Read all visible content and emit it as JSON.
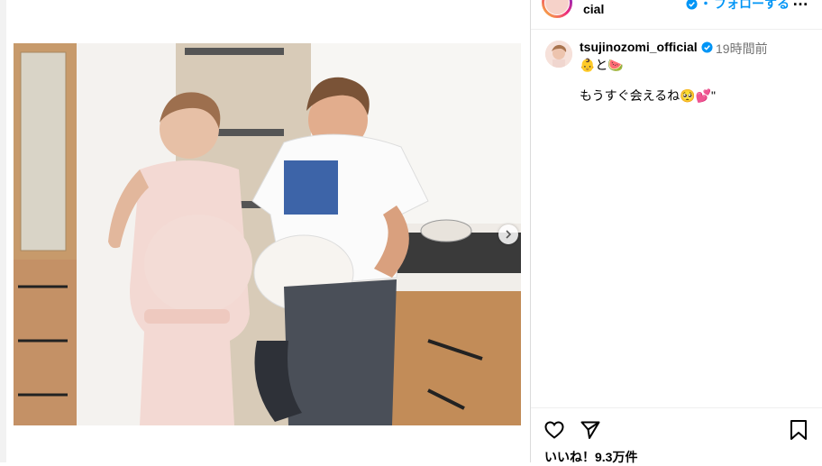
{
  "post": {
    "photo_alt": "photo",
    "next_icon": "chevron-right-icon"
  },
  "header": {
    "username_partial": "cial",
    "follow_label": "フォローする",
    "more_label": "…"
  },
  "caption": {
    "username": "tsujinozomi_official",
    "time": "19時間前",
    "emoji_line": "👶と🍉",
    "text": "もうすぐ会えるね🥺💕\""
  },
  "actions": {
    "likes": "いいね！9.3万件"
  },
  "colors": {
    "accent": "#0095f6",
    "verified": "#0095f6",
    "border": "#dbdbdb",
    "muted": "#737373"
  }
}
